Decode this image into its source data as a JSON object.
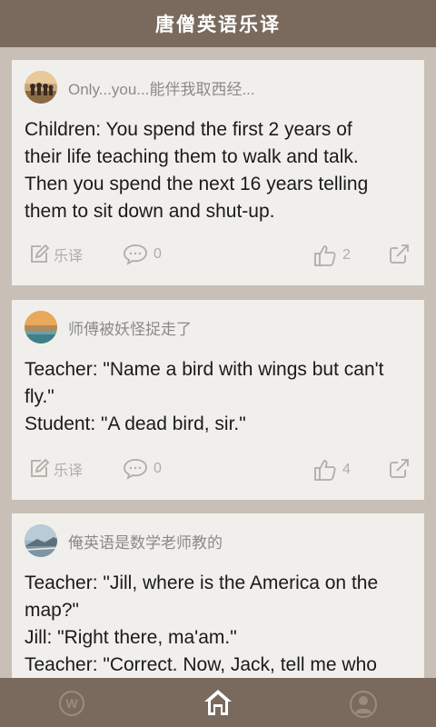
{
  "app": {
    "title": "唐僧英语乐译"
  },
  "posts": [
    {
      "username": "Only...you...能伴我取西经...",
      "lines": [
        "Children: You spend the first 2 years of",
        "their life teaching them to walk and talk.",
        "Then you spend the next 16 years telling",
        "them to sit down and shut-up."
      ],
      "translate_label": "乐译",
      "comments": "0",
      "likes": "2"
    },
    {
      "username": "师傅被妖怪捉走了",
      "lines": [
        "Teacher: \"Name a bird with wings but can't",
        "fly.\"",
        "Student: \"A dead bird, sir.\""
      ],
      "translate_label": "乐译",
      "comments": "0",
      "likes": "4"
    },
    {
      "username": "俺英语是数学老师教的",
      "lines": [
        "Teacher: \"Jill, where is the America on the",
        "map?\"",
        "Jill: \"Right there, ma'am.\"",
        "Teacher: \"Correct. Now, Jack, tell me who"
      ]
    }
  ],
  "tabbar": {
    "items": [
      {
        "name": "W",
        "icon": "w-circle-icon",
        "active": false
      },
      {
        "name": "home",
        "icon": "home-icon",
        "active": true
      },
      {
        "name": "profile",
        "icon": "profile-icon",
        "active": false
      }
    ]
  },
  "colors": {
    "header_bg": "#7a6a5d",
    "page_bg": "#c8bfb6",
    "card_bg": "#f1efec",
    "muted_icon": "#b0aca8"
  }
}
